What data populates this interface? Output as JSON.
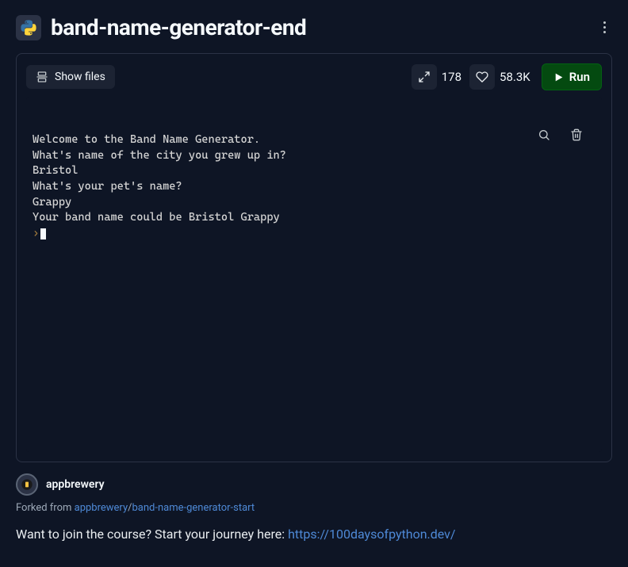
{
  "header": {
    "title": "band-name-generator-end"
  },
  "toolbar": {
    "showFiles": "Show files",
    "forks": "178",
    "likes": "58.3K",
    "run": "Run"
  },
  "console": {
    "lines": [
      "Welcome to the Band Name Generator.",
      "What's name of the city you grew up in?",
      "Bristol",
      "What's your pet's name?",
      "Grappy",
      "Your band name could be Bristol Grappy"
    ]
  },
  "author": {
    "name": "appbrewery"
  },
  "forked": {
    "prefix": "Forked from ",
    "owner": "appbrewery",
    "sep": "/",
    "repo": "band-name-generator-start"
  },
  "cta": {
    "text": "Want to join the course? Start your journey here: ",
    "link": "https://100daysofpython.dev/"
  }
}
